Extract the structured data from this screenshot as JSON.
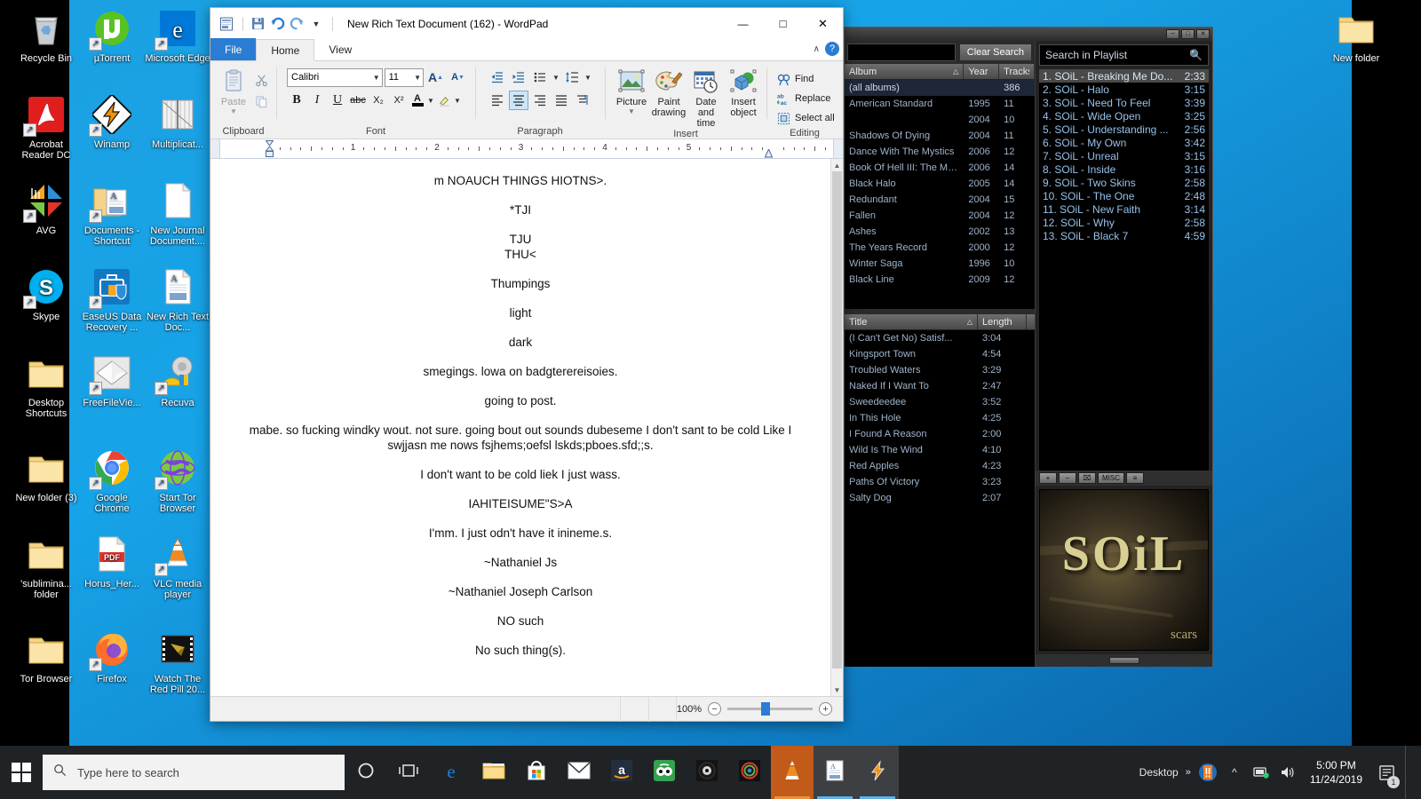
{
  "desktop": {
    "icons": [
      {
        "label": "Recycle Bin",
        "icon": "recycle-bin-icon",
        "shortcut": false,
        "col": 0,
        "row": 0
      },
      {
        "label": "Acrobat Reader DC",
        "icon": "acrobat-reader-icon",
        "shortcut": true,
        "col": 0,
        "row": 1
      },
      {
        "label": "AVG",
        "icon": "avg-icon",
        "shortcut": true,
        "col": 0,
        "row": 2
      },
      {
        "label": "Skype",
        "icon": "skype-icon",
        "shortcut": true,
        "col": 0,
        "row": 3
      },
      {
        "label": "Desktop Shortcuts",
        "icon": "folder-icon",
        "shortcut": false,
        "col": 0,
        "row": 4
      },
      {
        "label": "New folder (3)",
        "icon": "folder-icon",
        "shortcut": false,
        "col": 0,
        "row": 5
      },
      {
        "label": "'sublimina... folder",
        "icon": "folder-icon",
        "shortcut": false,
        "col": 0,
        "row": 6
      },
      {
        "label": "Tor Browser",
        "icon": "folder-icon",
        "shortcut": false,
        "col": 0,
        "row": 7
      },
      {
        "label": "µTorrent",
        "icon": "utorrent-icon",
        "shortcut": true,
        "col": 1,
        "row": 0
      },
      {
        "label": "Winamp",
        "icon": "winamp-icon",
        "shortcut": true,
        "col": 1,
        "row": 1
      },
      {
        "label": "Documents - Shortcut",
        "icon": "documents-folder-icon",
        "shortcut": true,
        "col": 1,
        "row": 2
      },
      {
        "label": "EaseUS Data Recovery ...",
        "icon": "easeus-icon",
        "shortcut": true,
        "col": 1,
        "row": 3
      },
      {
        "label": "FreeFileVie...",
        "icon": "freefileviewer-icon",
        "shortcut": true,
        "col": 1,
        "row": 4
      },
      {
        "label": "Google Chrome",
        "icon": "chrome-icon",
        "shortcut": true,
        "col": 1,
        "row": 5
      },
      {
        "label": "Horus_Her...",
        "icon": "pdf-file-icon",
        "shortcut": false,
        "col": 1,
        "row": 6
      },
      {
        "label": "Firefox",
        "icon": "firefox-icon",
        "shortcut": true,
        "col": 1,
        "row": 7
      },
      {
        "label": "Microsoft Edge",
        "icon": "edge-icon",
        "shortcut": true,
        "col": 2,
        "row": 0
      },
      {
        "label": "Multiplicat...",
        "icon": "image-file-icon",
        "shortcut": false,
        "col": 2,
        "row": 1
      },
      {
        "label": "New Journal Document....",
        "icon": "document-file-icon",
        "shortcut": false,
        "col": 2,
        "row": 2
      },
      {
        "label": "New Rich Text Doc...",
        "icon": "rtf-file-icon",
        "shortcut": false,
        "col": 2,
        "row": 3
      },
      {
        "label": "Recuva",
        "icon": "recuva-icon",
        "shortcut": true,
        "col": 2,
        "row": 4
      },
      {
        "label": "Start Tor Browser",
        "icon": "tor-icon",
        "shortcut": true,
        "col": 2,
        "row": 5
      },
      {
        "label": "VLC media player",
        "icon": "vlc-icon",
        "shortcut": true,
        "col": 2,
        "row": 6
      },
      {
        "label": "Watch The Red Pill 20...",
        "icon": "video-file-icon",
        "shortcut": false,
        "col": 2,
        "row": 7
      },
      {
        "label": "New folder",
        "icon": "folder-icon",
        "shortcut": false,
        "col": 3,
        "row": 0
      }
    ]
  },
  "wordpad": {
    "title": "New Rich Text Document (162) - WordPad",
    "quick_access": [
      "wordpad-doc-icon",
      "save-icon",
      "undo-icon",
      "redo-icon",
      "customize-qat-icon"
    ],
    "window_controls": {
      "minimize": "—",
      "maximize": "□",
      "close": "✕"
    },
    "tabs": [
      {
        "label": "File",
        "name": "tab-file"
      },
      {
        "label": "Home",
        "name": "tab-home"
      },
      {
        "label": "View",
        "name": "tab-view"
      }
    ],
    "help_label": "?",
    "collapse_label": "∧",
    "ribbon": {
      "clipboard": {
        "label": "Clipboard",
        "paste": "Paste",
        "cut": "cut-icon",
        "copy": "copy-icon"
      },
      "font": {
        "label": "Font",
        "family": "Calibri",
        "size": "11",
        "grow": "A",
        "shrink": "A",
        "bold": "B",
        "italic": "I",
        "underline": "U",
        "strikethrough": "abc",
        "subscript": "X₂",
        "superscript": "X²",
        "text_color": "A",
        "highlight": "highlight-icon"
      },
      "paragraph": {
        "label": "Paragraph",
        "decrease_indent": "decrease-indent-icon",
        "increase_indent": "increase-indent-icon",
        "bullets": "bullets-icon",
        "line_spacing": "line-spacing-icon",
        "align_left": "align-left-icon",
        "align_center": "align-center-icon",
        "align_right": "align-right-icon",
        "justify": "justify-icon",
        "paragraph_settings": "paragraph-settings-icon"
      },
      "insert": {
        "label": "Insert",
        "items": [
          {
            "label": "Picture",
            "icon": "picture-icon",
            "dropdown": true
          },
          {
            "label": "Paint drawing",
            "icon": "paint-drawing-icon",
            "dropdown": false
          },
          {
            "label": "Date and time",
            "icon": "date-and-time-icon",
            "dropdown": false
          },
          {
            "label": "Insert object",
            "icon": "insert-object-icon",
            "dropdown": false
          }
        ]
      },
      "editing": {
        "label": "Editing",
        "items": [
          {
            "label": "Find",
            "icon": "find-icon"
          },
          {
            "label": "Replace",
            "icon": "replace-icon"
          },
          {
            "label": "Select all",
            "icon": "select-all-icon"
          }
        ]
      }
    },
    "ruler": {
      "numbers": [
        "1",
        "2",
        "3",
        "4",
        "5"
      ]
    },
    "document": {
      "paragraphs": [
        "m NOAUCH THINGS HIOTNS>.",
        "*TJI",
        "TJU",
        "THU<",
        "Thumpings",
        "light",
        "dark",
        "smegings. lowa on badgterereisoies.",
        "going to post.",
        "mabe. so fucking windky wout. not sure. going bout out sounds dubeseme I don't sant to be cold Like I swjjasn me nows fsjhems;oefsl lskds;pboes.sfd;;s.",
        "I don't want to be cold liek I just wass.",
        "IAHITEISUME\"S>A",
        "I'mm. I just odn't have it inineme.s.",
        "~Nathaniel Js",
        "~Nathaniel Joseph Carlson",
        "NO such",
        "No such thing(s)."
      ]
    },
    "status": {
      "zoom": "100%",
      "zoom_out": "−",
      "zoom_in": "+"
    }
  },
  "winamp": {
    "window_buttons": [
      "minimize",
      "maximize",
      "close"
    ],
    "library": {
      "clear_search": "Clear Search",
      "columns": [
        "Album",
        "Year",
        "Tracks"
      ],
      "sort_indicator": "△",
      "rows": [
        {
          "album": "(all albums)",
          "year": "",
          "tracks": "386",
          "selected": true
        },
        {
          "album": "American Standard",
          "year": "1995",
          "tracks": "11"
        },
        {
          "album": "",
          "year": "2004",
          "tracks": "10"
        },
        {
          "album": "Shadows Of Dying",
          "year": "2004",
          "tracks": "11"
        },
        {
          "album": "Dance With The Mystics",
          "year": "2006",
          "tracks": "12"
        },
        {
          "album": "Book Of Hell III: The Mo...",
          "year": "2006",
          "tracks": "14"
        },
        {
          "album": "Black Halo",
          "year": "2005",
          "tracks": "14"
        },
        {
          "album": "Redundant",
          "year": "2004",
          "tracks": "15"
        },
        {
          "album": "Fallen",
          "year": "2004",
          "tracks": "12"
        },
        {
          "album": "Ashes",
          "year": "2002",
          "tracks": "13"
        },
        {
          "album": "The Years Record",
          "year": "2000",
          "tracks": "12"
        },
        {
          "album": "Winter Saga",
          "year": "1996",
          "tracks": "10"
        },
        {
          "album": "Black Line",
          "year": "2009",
          "tracks": "12"
        }
      ],
      "track_columns": [
        "Title",
        "Length"
      ],
      "tracks": [
        {
          "title": "(I Can't Get No) Satisf...",
          "length": "3:04"
        },
        {
          "title": "Kingsport Town",
          "length": "4:54"
        },
        {
          "title": "Troubled Waters",
          "length": "3:29"
        },
        {
          "title": "Naked If I Want To",
          "length": "2:47"
        },
        {
          "title": "Sweedeedee",
          "length": "3:52"
        },
        {
          "title": "In This Hole",
          "length": "4:25"
        },
        {
          "title": "I Found A Reason",
          "length": "2:00"
        },
        {
          "title": "Wild Is The Wind",
          "length": "4:10"
        },
        {
          "title": "Red Apples",
          "length": "4:23"
        },
        {
          "title": "Paths Of Victory",
          "length": "3:23"
        },
        {
          "title": "Salty Dog",
          "length": "2:07"
        }
      ]
    },
    "playlist": {
      "search_placeholder": "Search in Playlist",
      "search_icon": "magnifier-icon",
      "items": [
        {
          "n": "1.",
          "title": "SOiL - Breaking Me Do...",
          "time": "2:33",
          "current": true
        },
        {
          "n": "2.",
          "title": "SOiL - Halo",
          "time": "3:15"
        },
        {
          "n": "3.",
          "title": "SOiL - Need To Feel",
          "time": "3:39"
        },
        {
          "n": "4.",
          "title": "SOiL - Wide Open",
          "time": "3:25"
        },
        {
          "n": "5.",
          "title": "SOiL - Understanding ...",
          "time": "2:56"
        },
        {
          "n": "6.",
          "title": "SOiL - My Own",
          "time": "3:42"
        },
        {
          "n": "7.",
          "title": "SOiL - Unreal",
          "time": "3:15"
        },
        {
          "n": "8.",
          "title": "SOiL - Inside",
          "time": "3:16"
        },
        {
          "n": "9.",
          "title": "SOiL - Two Skins",
          "time": "2:58"
        },
        {
          "n": "10.",
          "title": "SOiL - The One",
          "time": "2:48"
        },
        {
          "n": "11.",
          "title": "SOiL - New Faith",
          "time": "3:14"
        },
        {
          "n": "12.",
          "title": "SOiL - Why",
          "time": "2:58"
        },
        {
          "n": "13.",
          "title": "SOiL - Black 7",
          "time": "4:59"
        }
      ],
      "buttons": [
        "+",
        "−",
        "⌧",
        "MISC",
        "≡"
      ]
    },
    "album_art": {
      "title": "SOiL",
      "subtitle": "scars"
    }
  },
  "taskbar": {
    "start_icon": "windows-start-icon",
    "search_placeholder": "Type here to search",
    "search_icon": "search-icon",
    "items": [
      {
        "name": "cortana-icon",
        "label": "Cortana"
      },
      {
        "name": "task-view-icon",
        "label": "Task View"
      },
      {
        "name": "edge-icon",
        "label": "Microsoft Edge"
      },
      {
        "name": "file-explorer-icon",
        "label": "File Explorer"
      },
      {
        "name": "microsoft-store-icon",
        "label": "Microsoft Store"
      },
      {
        "name": "mail-icon",
        "label": "Mail"
      },
      {
        "name": "amazon-icon",
        "label": "Amazon"
      },
      {
        "name": "tripadvisor-icon",
        "label": "TripAdvisor"
      },
      {
        "name": "avg-icon",
        "label": "AVG"
      },
      {
        "name": "spiral-icon",
        "label": "Media"
      },
      {
        "name": "vlc-icon",
        "label": "VLC media player"
      },
      {
        "name": "wordpad-icon",
        "label": "WordPad"
      },
      {
        "name": "winamp-icon",
        "label": "Winamp"
      }
    ],
    "desktop_label": "Desktop",
    "overflow": "»",
    "tray": [
      "avg-tray-icon",
      "chevron-up-icon",
      "network-icon",
      "volume-icon"
    ],
    "clock_time": "5:00 PM",
    "clock_date": "11/24/2019",
    "notifications_icon": "action-center-icon",
    "notification_count": "1"
  }
}
